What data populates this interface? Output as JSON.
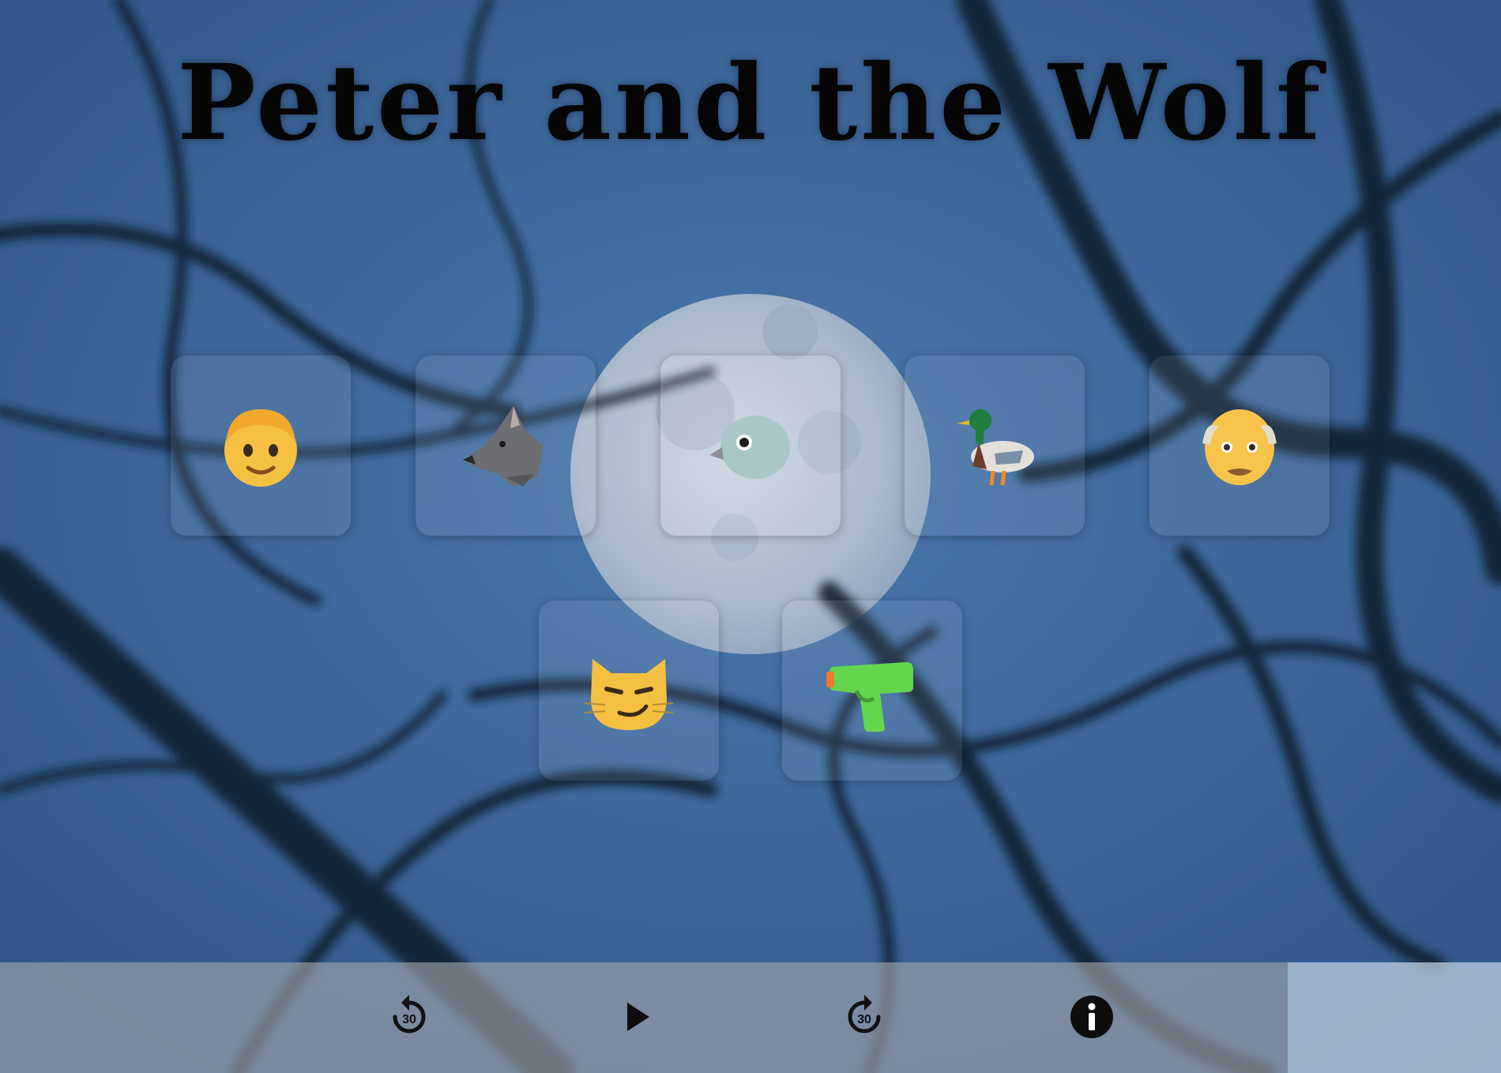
{
  "title": "Peter and the Wolf",
  "characters": [
    {
      "name": "peter",
      "icon": "boy-icon"
    },
    {
      "name": "wolf",
      "icon": "wolf-icon"
    },
    {
      "name": "bird",
      "icon": "bird-icon"
    },
    {
      "name": "duck",
      "icon": "duck-icon"
    },
    {
      "name": "grandfather",
      "icon": "old-man-icon"
    },
    {
      "name": "cat",
      "icon": "cat-icon"
    },
    {
      "name": "hunters",
      "icon": "water-pistol-icon"
    }
  ],
  "controls": {
    "rewind_label": "30",
    "forward_label": "30",
    "play_icon": "play-icon",
    "info_icon": "info-icon"
  },
  "colors": {
    "sky": "#3a6396",
    "title": "#050505",
    "bar": "#a5a8ad"
  }
}
